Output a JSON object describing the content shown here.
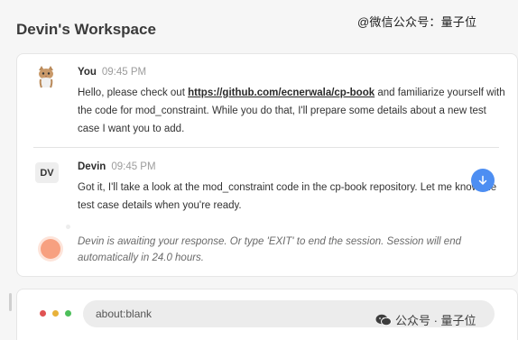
{
  "watermark_top": "@微信公众号：量子位",
  "workspace_title": "Devin's Workspace",
  "messages": [
    {
      "author": "You",
      "time": "09:45 PM",
      "avatar_icon": "cat-avatar-icon",
      "text_before_link": "Hello, please check out ",
      "link": "https://github.com/ecnerwala/cp-book",
      "text_after_link": " and familiarize yourself with the code for mod_constraint. While you do that, I'll prepare some details about a new test case I want you to add."
    },
    {
      "author": "Devin",
      "time": "09:45 PM",
      "avatar_initials": "DV",
      "text": "Got it, I'll take a look at the mod_constraint code in the cp-book repository. Let me know the test case details when you're ready."
    }
  ],
  "status": {
    "text": "Devin is awaiting your response. Or type 'EXIT' to end the session. Session will end automatically in 24.0 hours.",
    "dot_color": "#f7a080"
  },
  "browser": {
    "url": "about:blank"
  },
  "watermark_bottom": "公众号 · 量子位",
  "colors": {
    "accent": "#4d8ef2",
    "traffic_red": "#e05252",
    "traffic_yellow": "#e8b23a",
    "traffic_green": "#4cbf5a"
  }
}
